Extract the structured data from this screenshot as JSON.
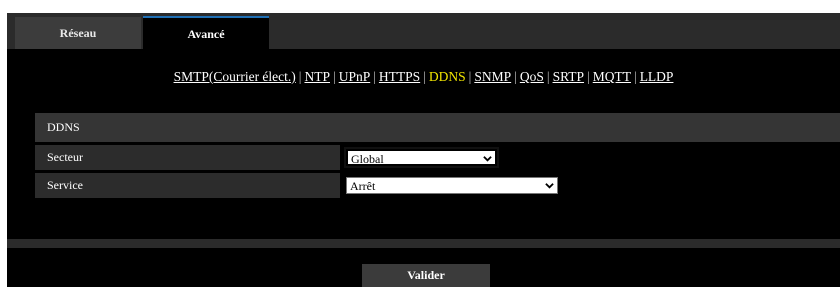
{
  "tabs": [
    {
      "label": "Réseau",
      "active": false
    },
    {
      "label": "Avancé",
      "active": true
    }
  ],
  "subnav": {
    "links": [
      "SMTP(Courrier élect.)",
      "NTP",
      "UPnP",
      "HTTPS",
      "DDNS",
      "SNMP",
      "QoS",
      "SRTP",
      "MQTT",
      "LLDP"
    ],
    "active": "DDNS",
    "separator": "|"
  },
  "section": {
    "title": "DDNS",
    "secteur": {
      "label": "Secteur",
      "value": "Global"
    },
    "service": {
      "label": "Service",
      "value": "Arrêt"
    }
  },
  "submit_label": "Valider",
  "colors": {
    "background": "#000000",
    "frame": "#2b2b2b",
    "active_link": "#f2e600",
    "tab_accent": "#1e6fb5"
  }
}
